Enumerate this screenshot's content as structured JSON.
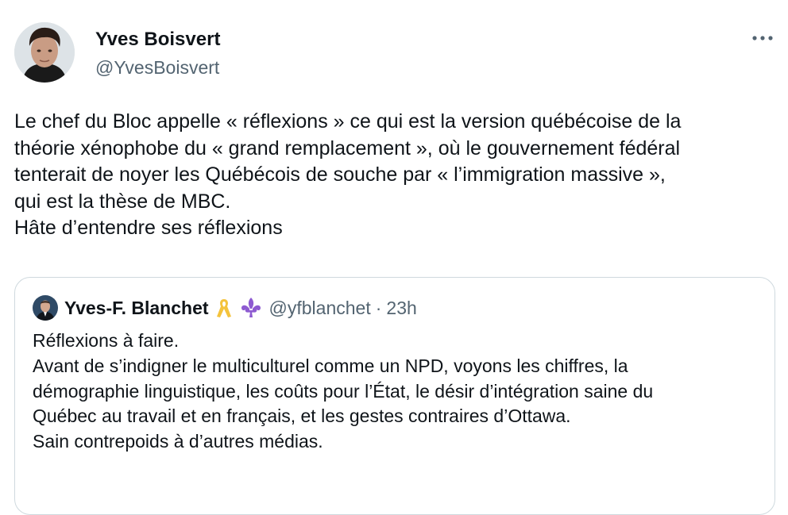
{
  "tweet": {
    "author": {
      "name": "Yves Boisvert",
      "handle": "@YvesBoisvert"
    },
    "text": "Le chef du Bloc appelle « réflexions » ce qui est la version québécoise de la\nthéorie xénophobe du « grand remplacement », où le gouvernement fédéral\ntenterait de noyer les Québécois de souche par « l’immigration massive »,\nqui est la thèse de MBC.\nHâte d’entendre ses réflexions"
  },
  "quoted": {
    "author": {
      "name": "Yves-F. Blanchet",
      "handle": "@yfblanchet",
      "separator": "·",
      "time": "23h"
    },
    "text": "Réflexions à faire.\nAvant de s’indigner le multiculturel comme un NPD, voyons les chiffres, la\ndémographie linguistique, les coûts pour l’État, le désir d’intégration saine du\nQuébec au travail et en français, et les gestes contraires d’Ottawa.\nSain contrepoids à d’autres médias."
  },
  "icons": {
    "more": "more-horizontal-icon",
    "ribbon": "yellow-ribbon-icon",
    "fleur": "fleur-de-lis-icon"
  },
  "colors": {
    "secondary_text": "#536471",
    "border": "#cfd9de",
    "ribbon": "#f4c33d",
    "fleur": "#8e5bd1"
  }
}
